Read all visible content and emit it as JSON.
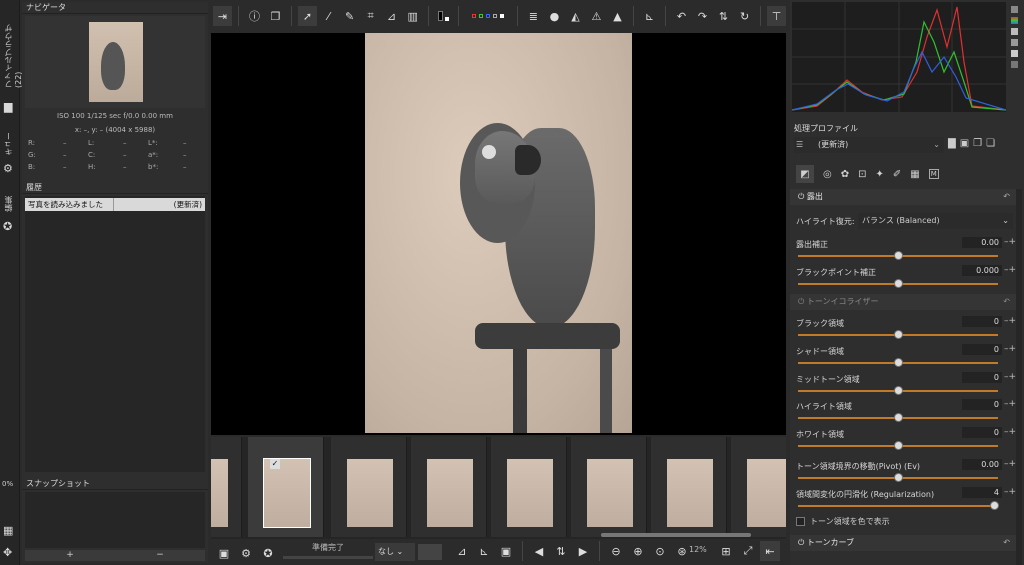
{
  "left_tabs": {
    "file_browser": "ファイルブラウザ (22)",
    "queue": "キュー",
    "editor": "編集"
  },
  "navigator": {
    "title": "ナビゲータ",
    "exif": "ISO 100   1/125 sec   f/0.0   0.00 mm",
    "coords": "x: –, y: –  (4004 x 5988)",
    "readouts": [
      [
        "R:",
        "–",
        "L:",
        "–",
        "L*:",
        "–"
      ],
      [
        "G:",
        "–",
        "C:",
        "–",
        "a*:",
        "–"
      ],
      [
        "B:",
        "–",
        "H:",
        "–",
        "b*:",
        "–"
      ]
    ]
  },
  "history": {
    "title": "履歴",
    "entry_label": "写真を読み込みました",
    "entry_state": "(更新済)"
  },
  "snapshots": {
    "title": "スナップショット",
    "add": "+",
    "remove": "−"
  },
  "left_percent": "0%",
  "bottom": {
    "status": "準備完了",
    "select": "なし",
    "zoom": "12%"
  },
  "profile": {
    "title": "処理プロファイル",
    "value": "(更新済)"
  },
  "exposure": {
    "title": "露出",
    "highlight_label": "ハイライト復元:",
    "highlight_value": "バランス (Balanced)",
    "comp_label": "露出補正",
    "comp_value": "0.00",
    "black_label": "ブラックポイント補正",
    "black_value": "0.000"
  },
  "tone_eq": {
    "title": "トーンイコライザー",
    "bands": [
      {
        "label": "ブラック領域",
        "value": "0"
      },
      {
        "label": "シャドー領域",
        "value": "0"
      },
      {
        "label": "ミッドトーン領域",
        "value": "0"
      },
      {
        "label": "ハイライト領域",
        "value": "0"
      },
      {
        "label": "ホワイト領域",
        "value": "0"
      }
    ],
    "pivot_label": "トーン領域境界の移動(Pivot) (Ev)",
    "pivot_value": "0.00",
    "reg_label": "領域間変化の円滑化 (Regularization)",
    "reg_value": "4",
    "color_label": "トーン領域を色で表示"
  },
  "tone_curve": {
    "title": "トーンカーブ"
  },
  "colors": {
    "accent": "#c07a28",
    "panel": "#2e2e2e",
    "viewer": "#000000"
  }
}
